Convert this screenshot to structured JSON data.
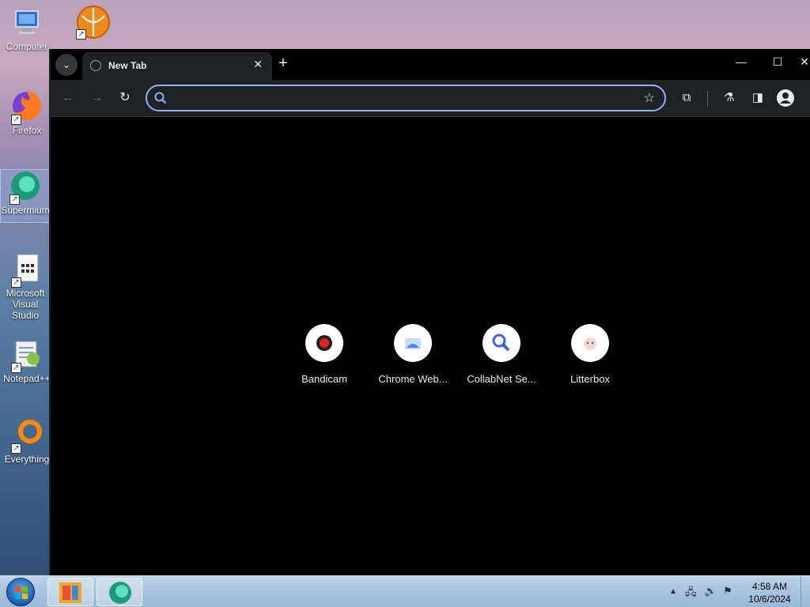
{
  "desktop": {
    "icons": [
      {
        "label": "Computer"
      },
      {
        "label": "Firefox"
      },
      {
        "label": "Supermium"
      },
      {
        "label": "Microsoft Visual Studio"
      },
      {
        "label": "Notepad++"
      },
      {
        "label": "Everything"
      }
    ]
  },
  "browser": {
    "tab": {
      "title": "New Tab",
      "close": "✕"
    },
    "newtab_label": "+",
    "window": {
      "minimize": "—",
      "maximize": "☐",
      "close": "✕"
    },
    "omnibox": {
      "value": "",
      "placeholder": ""
    },
    "shortcuts": [
      {
        "name": "Bandicam"
      },
      {
        "name": "Chrome Web..."
      },
      {
        "name": "CollabNet Se..."
      },
      {
        "name": "Litterbox"
      }
    ]
  },
  "taskbar": {
    "clock_time": "4:58 AM",
    "clock_date": "10/6/2024"
  },
  "colors": {
    "accent": "#8ab4f8",
    "window_bg": "#000000",
    "toolbar_bg": "#202124"
  }
}
